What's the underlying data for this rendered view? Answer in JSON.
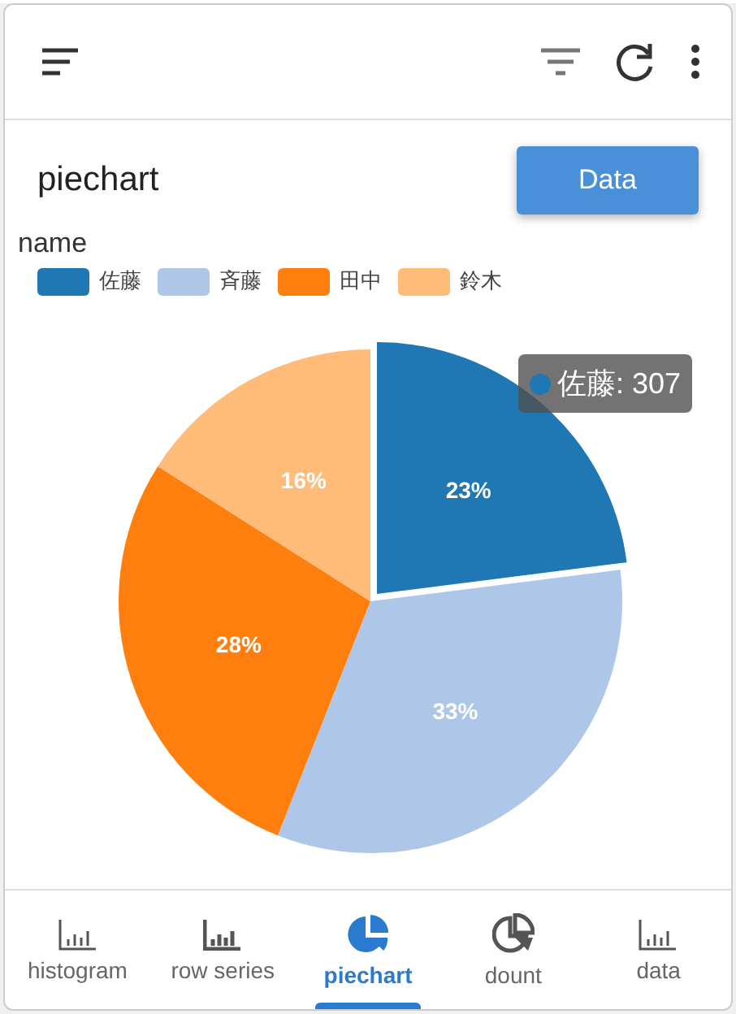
{
  "title": "piechart",
  "data_button": "Data",
  "chart": {
    "legend_title": "name",
    "tooltip": {
      "label": "佐藤: 307",
      "color": "#1f77b4"
    },
    "chart_data": {
      "type": "pie",
      "categories": [
        "佐藤",
        "斉藤",
        "田中",
        "鈴木"
      ],
      "series": [
        {
          "values": [
            23,
            33,
            28,
            16
          ]
        }
      ],
      "colors": [
        "#1f77b4",
        "#aec7e8",
        "#ff7f0e",
        "#ffbb78"
      ],
      "value_labels": [
        "23%",
        "33%",
        "28%",
        "16%"
      ]
    }
  },
  "tabs": [
    {
      "label": "histogram",
      "selected": false
    },
    {
      "label": "row series",
      "selected": false
    },
    {
      "label": "piechart",
      "selected": true
    },
    {
      "label": "dount",
      "selected": false
    },
    {
      "label": "data",
      "selected": false
    }
  ]
}
